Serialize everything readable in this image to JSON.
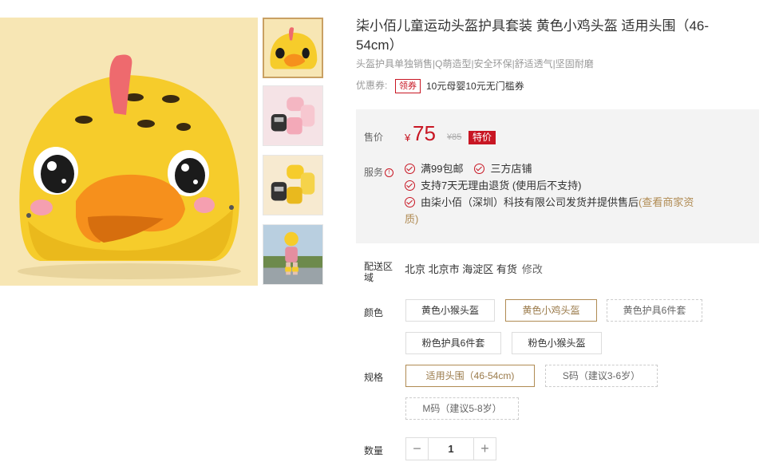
{
  "product": {
    "title": "柒小佰儿童运动头盔护具套装 黄色小鸡头盔 适用头围（46-54cm）",
    "subtitle": "头盔护具单独销售|Q萌造型|安全环保|舒适透气|坚固耐磨"
  },
  "coupon": {
    "label": "优惠券:",
    "tag": "领券",
    "text": "10元母婴10元无门槛券"
  },
  "price": {
    "label": "售价",
    "currency": "¥",
    "value": "75",
    "original": "¥85",
    "badge": "特价"
  },
  "service": {
    "label": "服务",
    "info_icon": "!",
    "items_line1": [
      "满99包邮",
      "三方店铺"
    ],
    "line2": "支持7天无理由退货 (使用后不支持)",
    "line3_text": "由柒小佰（深圳）科技有限公司发货并提供售后",
    "line3_link": "(查看商家资",
    "line3_link_cont": "质)"
  },
  "delivery": {
    "label_1": "配送区",
    "label_2": "域",
    "location": "北京 北京市 海淀区 有货",
    "edit": "修改"
  },
  "color": {
    "label": "颜色",
    "options": [
      "黄色小猴头盔",
      "黄色小鸡头盔",
      "黄色护具6件套",
      "粉色护具6件套",
      "粉色小猴头盔"
    ],
    "selected": "黄色小鸡头盔"
  },
  "size": {
    "label": "规格",
    "options": [
      "适用头围（46-54cm)",
      "S码（建议3-6岁）",
      "M码（建议5-8岁）"
    ],
    "selected": "适用头围（46-54cm)"
  },
  "quantity": {
    "label": "数量",
    "value": "1",
    "minus": "−",
    "plus": "+"
  },
  "colors": {
    "accent_red": "#c81623",
    "gold": "#b08b53",
    "panel_bg": "#f3f3f3",
    "image_bg": "#f7e6b4"
  },
  "icons": [
    "info-icon",
    "check-circle-icon",
    "minus-icon",
    "plus-icon"
  ]
}
